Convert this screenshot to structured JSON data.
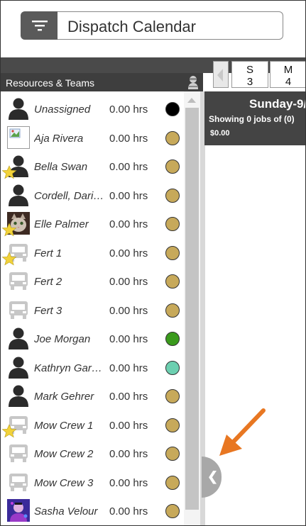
{
  "header": {
    "title": "Dispatch Calendar",
    "menu_icon": "filter-lines-icon"
  },
  "sidebar": {
    "title": "Resources & Teams",
    "resources": [
      {
        "name": "Unassigned",
        "hours": "0.00 hrs",
        "avatar": "person",
        "status_color": "#000000",
        "starred": false
      },
      {
        "name": "Aja Rivera",
        "hours": "0.00 hrs",
        "avatar": "broken-image",
        "status_color": "#c7a95a",
        "starred": false
      },
      {
        "name": "Bella Swan",
        "hours": "0.00 hrs",
        "avatar": "person",
        "status_color": "#c7a95a",
        "starred": true
      },
      {
        "name": "Cordell, Dari…",
        "hours": "0.00 hrs",
        "avatar": "person",
        "status_color": "#c7a95a",
        "starred": false
      },
      {
        "name": "Elle Palmer",
        "hours": "0.00 hrs",
        "avatar": "photo-cat",
        "status_color": "#c7a95a",
        "starred": true
      },
      {
        "name": "Fert 1",
        "hours": "0.00 hrs",
        "avatar": "truck",
        "status_color": "#c7a95a",
        "starred": true
      },
      {
        "name": "Fert 2",
        "hours": "0.00 hrs",
        "avatar": "truck",
        "status_color": "#c7a95a",
        "starred": false
      },
      {
        "name": "Fert 3",
        "hours": "0.00 hrs",
        "avatar": "truck",
        "status_color": "#c7a95a",
        "starred": false
      },
      {
        "name": "Joe Morgan",
        "hours": "0.00 hrs",
        "avatar": "person",
        "status_color": "#3a9a1c",
        "starred": false
      },
      {
        "name": "Kathryn Gar…",
        "hours": "0.00 hrs",
        "avatar": "person",
        "status_color": "#6ccfb0",
        "starred": false
      },
      {
        "name": "Mark Gehrer",
        "hours": "0.00 hrs",
        "avatar": "person",
        "status_color": "#c7a95a",
        "starred": false
      },
      {
        "name": "Mow Crew 1",
        "hours": "0.00 hrs",
        "avatar": "truck",
        "status_color": "#c7a95a",
        "starred": true
      },
      {
        "name": "Mow Crew 2",
        "hours": "0.00 hrs",
        "avatar": "truck",
        "status_color": "#c7a95a",
        "starred": false
      },
      {
        "name": "Mow Crew 3",
        "hours": "0.00 hrs",
        "avatar": "truck",
        "status_color": "#c7a95a",
        "starred": false
      },
      {
        "name": "Sasha Velour",
        "hours": "0.00 hrs",
        "avatar": "photo-purple",
        "status_color": "#c7a95a",
        "starred": false
      }
    ]
  },
  "calendar": {
    "days": [
      {
        "letter": "S",
        "number": "3"
      },
      {
        "letter": "M",
        "number": "4"
      }
    ],
    "day_header": {
      "title": "Sunday-9/",
      "jobs_text": "Showing 0 jobs of (0)",
      "amount": "$0.00"
    },
    "collapse_glyph": "❮"
  },
  "colors": {
    "annotation_arrow": "#e87722",
    "star": "#f2d23a"
  }
}
